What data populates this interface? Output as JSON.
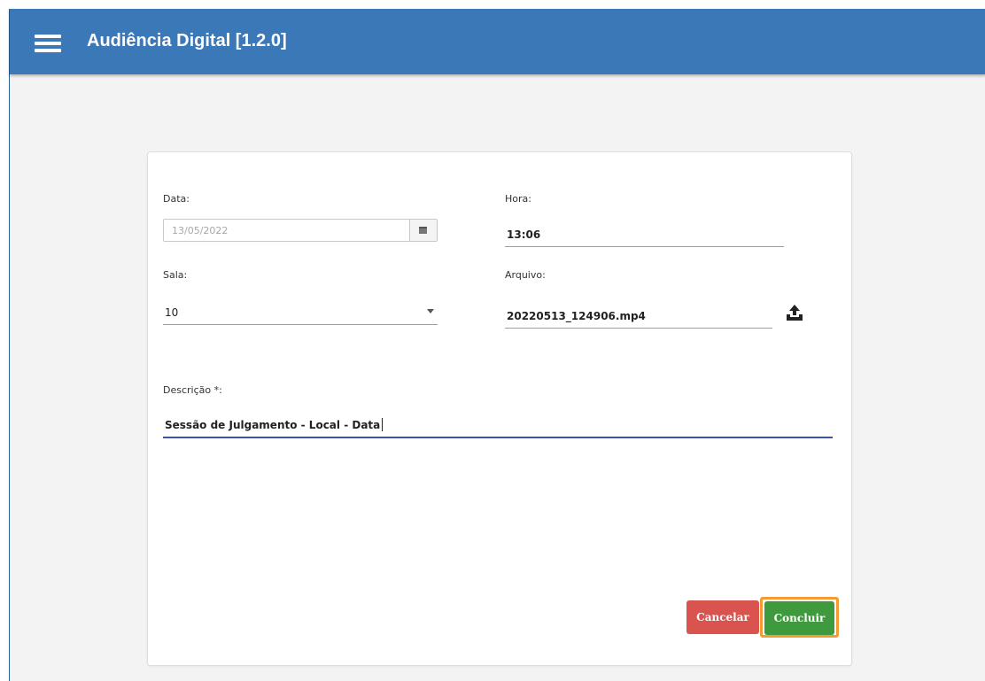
{
  "app": {
    "title": "Audiência Digital [1.2.0]",
    "menu_icon": "hamburger-menu-icon"
  },
  "form": {
    "data": {
      "label": "Data:",
      "value": "13/05/2022",
      "icon": "calendar-icon"
    },
    "hora": {
      "label": "Hora:",
      "value": "13:06"
    },
    "sala": {
      "label": "Sala:",
      "value": "10",
      "icon": "chevron-down-icon"
    },
    "arquivo": {
      "label": "Arquivo:",
      "value": "20220513_124906.mp4",
      "icon": "upload-icon"
    },
    "descricao": {
      "label": "Descrição *:",
      "value": "Sessão de Julgamento - Local - Data"
    }
  },
  "actions": {
    "cancel_label": "Cancelar",
    "confirm_label": "Concluir"
  },
  "colors": {
    "appbar": "#3a78b8",
    "cancel": "#d9534f",
    "confirm": "#3e9a3c",
    "highlight": "#f39c33",
    "focus_underline": "#3f51b5"
  }
}
